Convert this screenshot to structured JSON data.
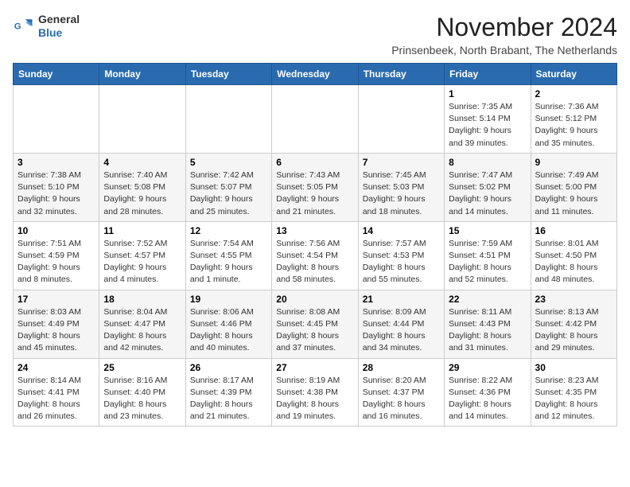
{
  "logo": {
    "general": "General",
    "blue": "Blue"
  },
  "title": "November 2024",
  "subtitle": "Prinsenbeek, North Brabant, The Netherlands",
  "days_header": [
    "Sunday",
    "Monday",
    "Tuesday",
    "Wednesday",
    "Thursday",
    "Friday",
    "Saturday"
  ],
  "weeks": [
    [
      {
        "day": "",
        "info": ""
      },
      {
        "day": "",
        "info": ""
      },
      {
        "day": "",
        "info": ""
      },
      {
        "day": "",
        "info": ""
      },
      {
        "day": "",
        "info": ""
      },
      {
        "day": "1",
        "info": "Sunrise: 7:35 AM\nSunset: 5:14 PM\nDaylight: 9 hours and 39 minutes."
      },
      {
        "day": "2",
        "info": "Sunrise: 7:36 AM\nSunset: 5:12 PM\nDaylight: 9 hours and 35 minutes."
      }
    ],
    [
      {
        "day": "3",
        "info": "Sunrise: 7:38 AM\nSunset: 5:10 PM\nDaylight: 9 hours and 32 minutes."
      },
      {
        "day": "4",
        "info": "Sunrise: 7:40 AM\nSunset: 5:08 PM\nDaylight: 9 hours and 28 minutes."
      },
      {
        "day": "5",
        "info": "Sunrise: 7:42 AM\nSunset: 5:07 PM\nDaylight: 9 hours and 25 minutes."
      },
      {
        "day": "6",
        "info": "Sunrise: 7:43 AM\nSunset: 5:05 PM\nDaylight: 9 hours and 21 minutes."
      },
      {
        "day": "7",
        "info": "Sunrise: 7:45 AM\nSunset: 5:03 PM\nDaylight: 9 hours and 18 minutes."
      },
      {
        "day": "8",
        "info": "Sunrise: 7:47 AM\nSunset: 5:02 PM\nDaylight: 9 hours and 14 minutes."
      },
      {
        "day": "9",
        "info": "Sunrise: 7:49 AM\nSunset: 5:00 PM\nDaylight: 9 hours and 11 minutes."
      }
    ],
    [
      {
        "day": "10",
        "info": "Sunrise: 7:51 AM\nSunset: 4:59 PM\nDaylight: 9 hours and 8 minutes."
      },
      {
        "day": "11",
        "info": "Sunrise: 7:52 AM\nSunset: 4:57 PM\nDaylight: 9 hours and 4 minutes."
      },
      {
        "day": "12",
        "info": "Sunrise: 7:54 AM\nSunset: 4:55 PM\nDaylight: 9 hours and 1 minute."
      },
      {
        "day": "13",
        "info": "Sunrise: 7:56 AM\nSunset: 4:54 PM\nDaylight: 8 hours and 58 minutes."
      },
      {
        "day": "14",
        "info": "Sunrise: 7:57 AM\nSunset: 4:53 PM\nDaylight: 8 hours and 55 minutes."
      },
      {
        "day": "15",
        "info": "Sunrise: 7:59 AM\nSunset: 4:51 PM\nDaylight: 8 hours and 52 minutes."
      },
      {
        "day": "16",
        "info": "Sunrise: 8:01 AM\nSunset: 4:50 PM\nDaylight: 8 hours and 48 minutes."
      }
    ],
    [
      {
        "day": "17",
        "info": "Sunrise: 8:03 AM\nSunset: 4:49 PM\nDaylight: 8 hours and 45 minutes."
      },
      {
        "day": "18",
        "info": "Sunrise: 8:04 AM\nSunset: 4:47 PM\nDaylight: 8 hours and 42 minutes."
      },
      {
        "day": "19",
        "info": "Sunrise: 8:06 AM\nSunset: 4:46 PM\nDaylight: 8 hours and 40 minutes."
      },
      {
        "day": "20",
        "info": "Sunrise: 8:08 AM\nSunset: 4:45 PM\nDaylight: 8 hours and 37 minutes."
      },
      {
        "day": "21",
        "info": "Sunrise: 8:09 AM\nSunset: 4:44 PM\nDaylight: 8 hours and 34 minutes."
      },
      {
        "day": "22",
        "info": "Sunrise: 8:11 AM\nSunset: 4:43 PM\nDaylight: 8 hours and 31 minutes."
      },
      {
        "day": "23",
        "info": "Sunrise: 8:13 AM\nSunset: 4:42 PM\nDaylight: 8 hours and 29 minutes."
      }
    ],
    [
      {
        "day": "24",
        "info": "Sunrise: 8:14 AM\nSunset: 4:41 PM\nDaylight: 8 hours and 26 minutes."
      },
      {
        "day": "25",
        "info": "Sunrise: 8:16 AM\nSunset: 4:40 PM\nDaylight: 8 hours and 23 minutes."
      },
      {
        "day": "26",
        "info": "Sunrise: 8:17 AM\nSunset: 4:39 PM\nDaylight: 8 hours and 21 minutes."
      },
      {
        "day": "27",
        "info": "Sunrise: 8:19 AM\nSunset: 4:38 PM\nDaylight: 8 hours and 19 minutes."
      },
      {
        "day": "28",
        "info": "Sunrise: 8:20 AM\nSunset: 4:37 PM\nDaylight: 8 hours and 16 minutes."
      },
      {
        "day": "29",
        "info": "Sunrise: 8:22 AM\nSunset: 4:36 PM\nDaylight: 8 hours and 14 minutes."
      },
      {
        "day": "30",
        "info": "Sunrise: 8:23 AM\nSunset: 4:35 PM\nDaylight: 8 hours and 12 minutes."
      }
    ]
  ]
}
